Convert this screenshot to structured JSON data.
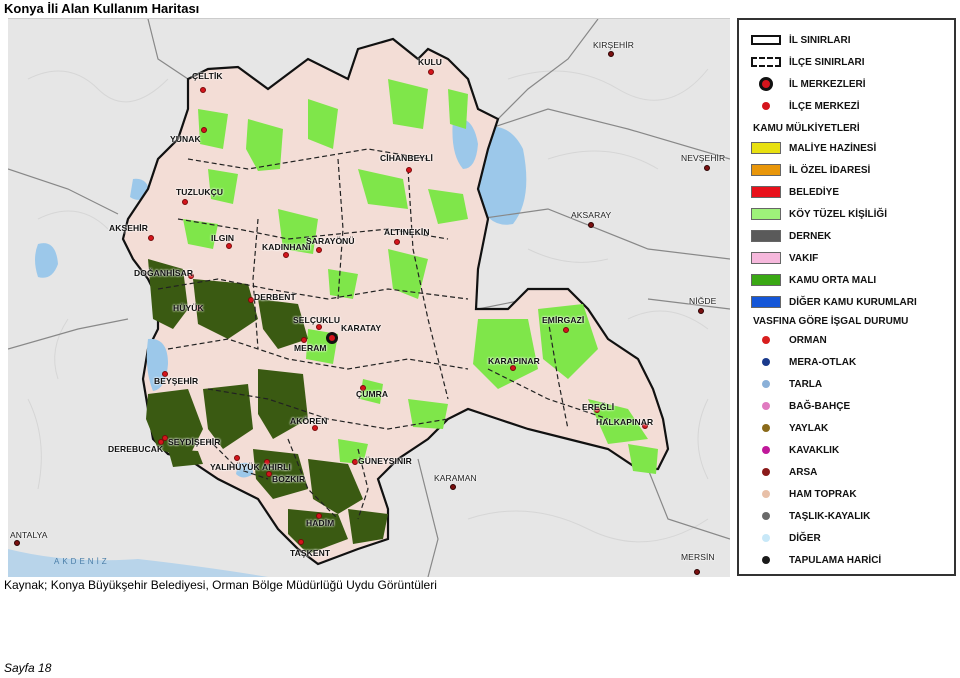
{
  "title": "Konya İli   Alan Kullanım Haritası",
  "caption": "Kaynak; Konya Büyükşehir Belediyesi, Orman Bölge Müdürlüğü Uydu Görüntüleri",
  "page_number": "Sayfa 18",
  "map": {
    "province_center": "KARATAY",
    "district_centers": [
      "KULU",
      "ÇELTİK",
      "YUNAK",
      "CİHANBEYLİ",
      "TUZLUKÇU",
      "AKŞEHİR",
      "ILGIN",
      "KADINHANI",
      "SARAYÖNÜ",
      "ALTINEKİN",
      "DOĞANHİSAR",
      "HÜYÜK",
      "DERBENT",
      "SELÇUKLU",
      "MERAM",
      "EMİRGAZİ",
      "KARAPINAR",
      "BEYŞEHİR",
      "ÇUMRA",
      "EREĞLİ",
      "HALKAPINAR",
      "AKÖREN",
      "SEYDİŞEHİR",
      "DEREBUCAK",
      "GÜNEYSINIR",
      "YALIHÜYÜK",
      "AHIRLI",
      "BOZKIR",
      "HADİM",
      "TAŞKENT"
    ],
    "neighbor_cities": [
      "KIRŞEHİR",
      "NEVŞEHİR",
      "AKSARAY",
      "NİĞDE",
      "KARAMAN",
      "MERSİN",
      "ANTALYA"
    ],
    "sea_label": "AKDENİZ"
  },
  "legend": {
    "boundaries": [
      {
        "label": "İL SINIRLARI",
        "style": "double-solid"
      },
      {
        "label": "İLÇE SINIRLARI",
        "style": "dashed"
      },
      {
        "label": "İL MERKEZLERİ",
        "style": "center-point"
      },
      {
        "label": "İLÇE MERKEZİ",
        "style": "point"
      }
    ],
    "ownership_title": "KAMU MÜLKİYETLERİ",
    "ownership": [
      {
        "label": "MALİYE HAZİNESİ",
        "color": "#e8e010"
      },
      {
        "label": "İL ÖZEL İDARESİ",
        "color": "#e8960a"
      },
      {
        "label": "BELEDİYE",
        "color": "#e8101a"
      },
      {
        "label": "KÖY TÜZEL KİŞİLİĞİ",
        "color": "#9ef27a"
      },
      {
        "label": "DERNEK",
        "color": "#5a5a5a"
      },
      {
        "label": "VAKIF",
        "color": "#f6b8dc"
      },
      {
        "label": "KAMU ORTA MALI",
        "color": "#3aa814"
      },
      {
        "label": "DİĞER KAMU KURUMLARI",
        "color": "#1456d8"
      }
    ],
    "occupation_title": "VASFINA GÖRE İŞGAL DURUMU",
    "occupation": [
      {
        "label": "ORMAN",
        "color": "#d81e1e"
      },
      {
        "label": "MERA-OTLAK",
        "color": "#1a3a8c"
      },
      {
        "label": "TARLA",
        "color": "#8ab0d8"
      },
      {
        "label": "BAĞ-BAHÇE",
        "color": "#e07ac0"
      },
      {
        "label": "YAYLAK",
        "color": "#8a6a1a"
      },
      {
        "label": "KAVAKLIK",
        "color": "#c0189a"
      },
      {
        "label": "ARSA",
        "color": "#8a1a1a"
      },
      {
        "label": "HAM TOPRAK",
        "color": "#e8c0a8"
      },
      {
        "label": "TAŞLIK-KAYALIK",
        "color": "#6a6a6a"
      },
      {
        "label": "DİĞER",
        "color": "#c8e8f8"
      },
      {
        "label": "TAPULAMA HARİCİ",
        "color": "#1a1a1a"
      }
    ]
  },
  "colors": {
    "province_fill": "#f3ddd6",
    "background": "#e6e6e6",
    "water": "#9cc8ea",
    "green_light": "#7fe64a",
    "green_dark": "#3a5a12"
  }
}
